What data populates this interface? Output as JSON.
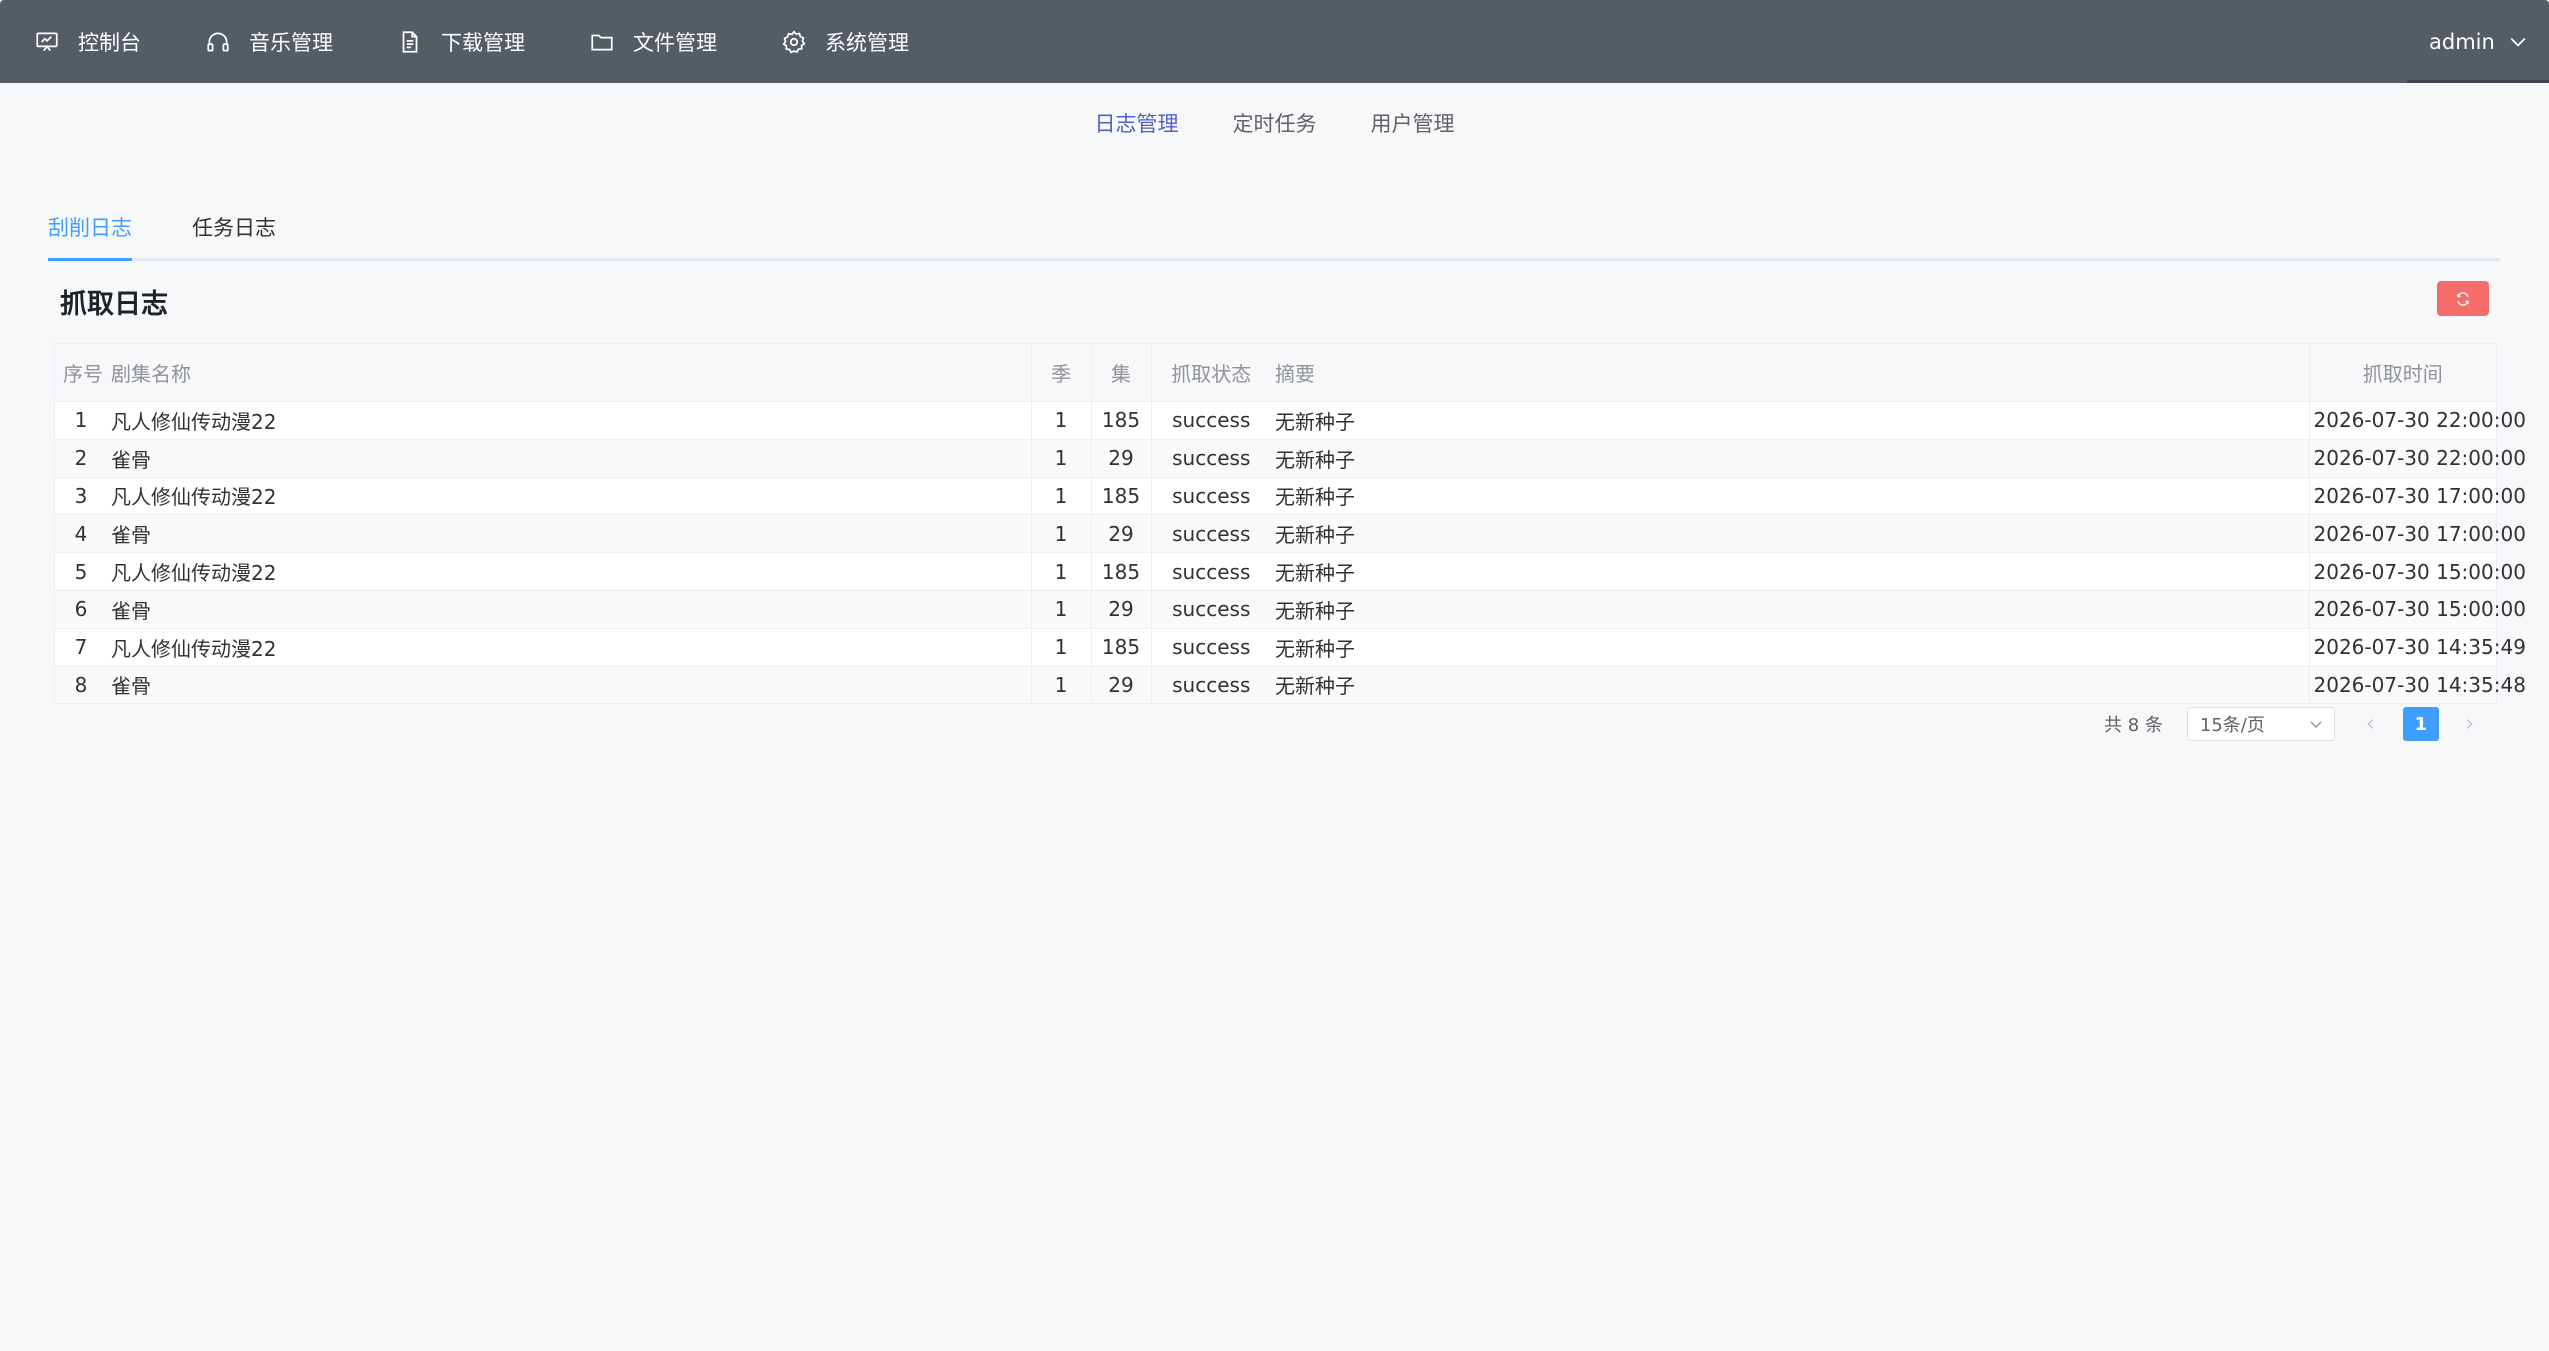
{
  "topnav": {
    "items": [
      {
        "label": "控制台",
        "icon": "dashboard-icon"
      },
      {
        "label": "音乐管理",
        "icon": "headphones-icon"
      },
      {
        "label": "下载管理",
        "icon": "document-icon"
      },
      {
        "label": "文件管理",
        "icon": "folder-icon"
      },
      {
        "label": "系统管理",
        "icon": "gear-icon"
      }
    ],
    "user": "admin"
  },
  "subnav": {
    "items": [
      "日志管理",
      "定时任务",
      "用户管理"
    ],
    "active": "日志管理"
  },
  "tabs": {
    "items": [
      "刮削日志",
      "任务日志"
    ],
    "active": "刮削日志"
  },
  "card": {
    "title": "抓取日志"
  },
  "table": {
    "headers": [
      "序号",
      "剧集名称",
      "季",
      "集",
      "抓取状态",
      "摘要",
      "抓取时间"
    ],
    "rows": [
      [
        "1",
        "凡人修仙传动漫22",
        "1",
        "185",
        "success",
        "无新种子",
        "2026-07-30 22:00:00"
      ],
      [
        "2",
        "雀骨",
        "1",
        "29",
        "success",
        "无新种子",
        "2026-07-30 22:00:00"
      ],
      [
        "3",
        "凡人修仙传动漫22",
        "1",
        "185",
        "success",
        "无新种子",
        "2026-07-30 17:00:00"
      ],
      [
        "4",
        "雀骨",
        "1",
        "29",
        "success",
        "无新种子",
        "2026-07-30 17:00:00"
      ],
      [
        "5",
        "凡人修仙传动漫22",
        "1",
        "185",
        "success",
        "无新种子",
        "2026-07-30 15:00:00"
      ],
      [
        "6",
        "雀骨",
        "1",
        "29",
        "success",
        "无新种子",
        "2026-07-30 15:00:00"
      ],
      [
        "7",
        "凡人修仙传动漫22",
        "1",
        "185",
        "success",
        "无新种子",
        "2026-07-30 14:35:49"
      ],
      [
        "8",
        "雀骨",
        "1",
        "29",
        "success",
        "无新种子",
        "2026-07-30 14:35:48"
      ]
    ]
  },
  "pagination": {
    "total": "共 8 条",
    "page_size": "15条/页",
    "current_page": "1"
  },
  "colors": {
    "topbar": "#545c64",
    "accent": "#409eff",
    "subnav_active": "#4f5fc8",
    "danger": "#f56c6c"
  }
}
